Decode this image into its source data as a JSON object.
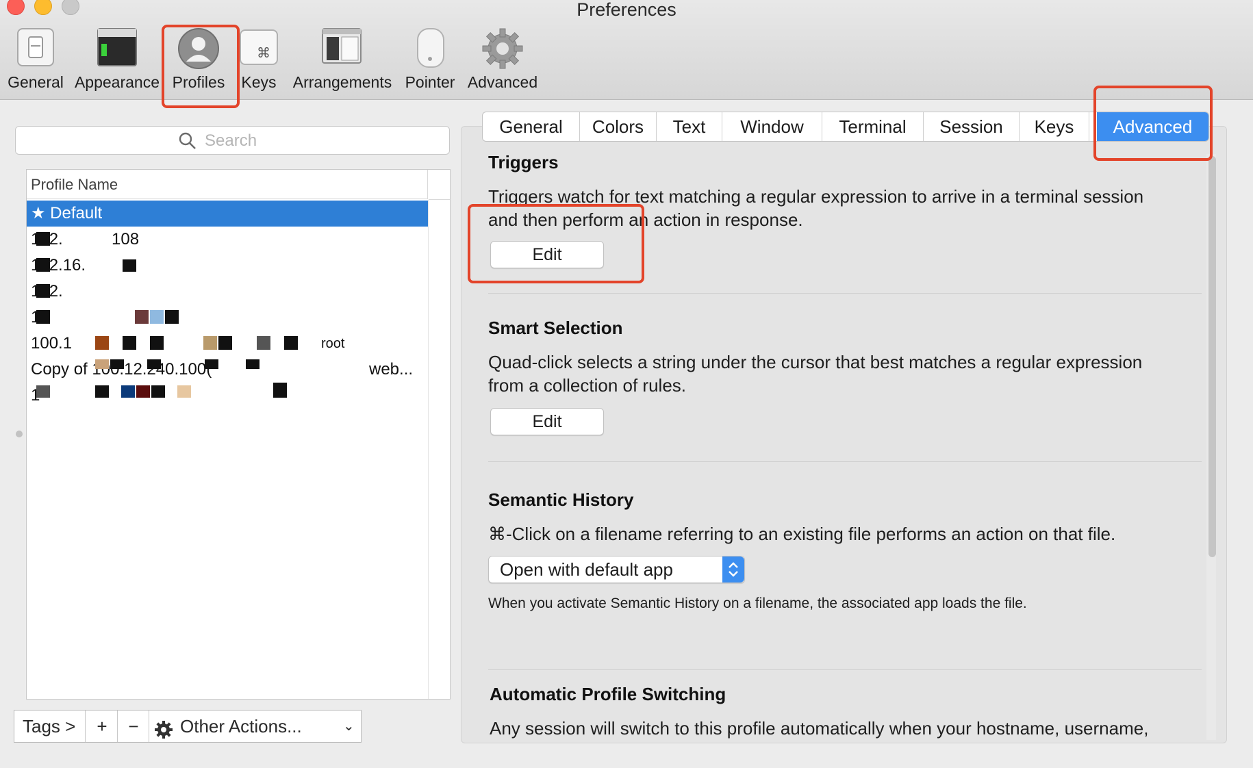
{
  "window": {
    "title": "Preferences"
  },
  "toolbar": {
    "items": [
      {
        "label": "General",
        "icon": "general-switch-icon"
      },
      {
        "label": "Appearance",
        "icon": "appearance-window-icon"
      },
      {
        "label": "Profiles",
        "icon": "profiles-user-icon"
      },
      {
        "label": "Keys",
        "icon": "command-key-icon"
      },
      {
        "label": "Arrangements",
        "icon": "arrangements-window-icon"
      },
      {
        "label": "Pointer",
        "icon": "mouse-icon"
      },
      {
        "label": "Advanced",
        "icon": "gear-icon"
      }
    ],
    "selected": "Profiles"
  },
  "sidebar": {
    "search_placeholder": "Search",
    "column_header": "Profile Name",
    "profiles": [
      {
        "label": "★ Default",
        "selected": true
      },
      {
        "label": "172.",
        "suffix": "108"
      },
      {
        "label": "172.16.",
        "suffix": ""
      },
      {
        "label": "172.",
        "suffix": ""
      },
      {
        "label": "1",
        "suffix": ""
      },
      {
        "label": "100.1",
        "suffix": "root"
      },
      {
        "label": "Copy of 100.12.240.100(",
        "suffix": "web..."
      },
      {
        "label": "1",
        "suffix": ""
      }
    ],
    "bottom": {
      "tags_label": "Tags >",
      "add_label": "+",
      "remove_label": "−",
      "actions_label": "Other Actions..."
    }
  },
  "tabs": {
    "items": [
      "General",
      "Colors",
      "Text",
      "Window",
      "Terminal",
      "Session",
      "Keys",
      "Advanced"
    ],
    "active": "Advanced"
  },
  "advanced": {
    "triggers": {
      "title": "Triggers",
      "description_line1": "Triggers watch for text matching a regular expression to arrive in a terminal session",
      "description_line2": "and then perform an action in response.",
      "button": "Edit"
    },
    "smart_selection": {
      "title": "Smart Selection",
      "description_line1": "Quad-click selects a string under the cursor that best matches a regular expression",
      "description_line2": "from a collection of rules.",
      "button": "Edit"
    },
    "semantic_history": {
      "title": "Semantic History",
      "description": "⌘-Click on a filename referring to an existing file performs an action on that file.",
      "select_value": "Open with default app",
      "note": "When you activate Semantic History on a filename, the associated app loads the file."
    },
    "auto_profile_switching": {
      "title": "Automatic Profile Switching",
      "description": "Any session will switch to this profile automatically when your hostname, username,"
    }
  },
  "colors": {
    "accent": "#3c8ef0",
    "selection": "#2e7fd6",
    "highlight": "#e3442a"
  }
}
